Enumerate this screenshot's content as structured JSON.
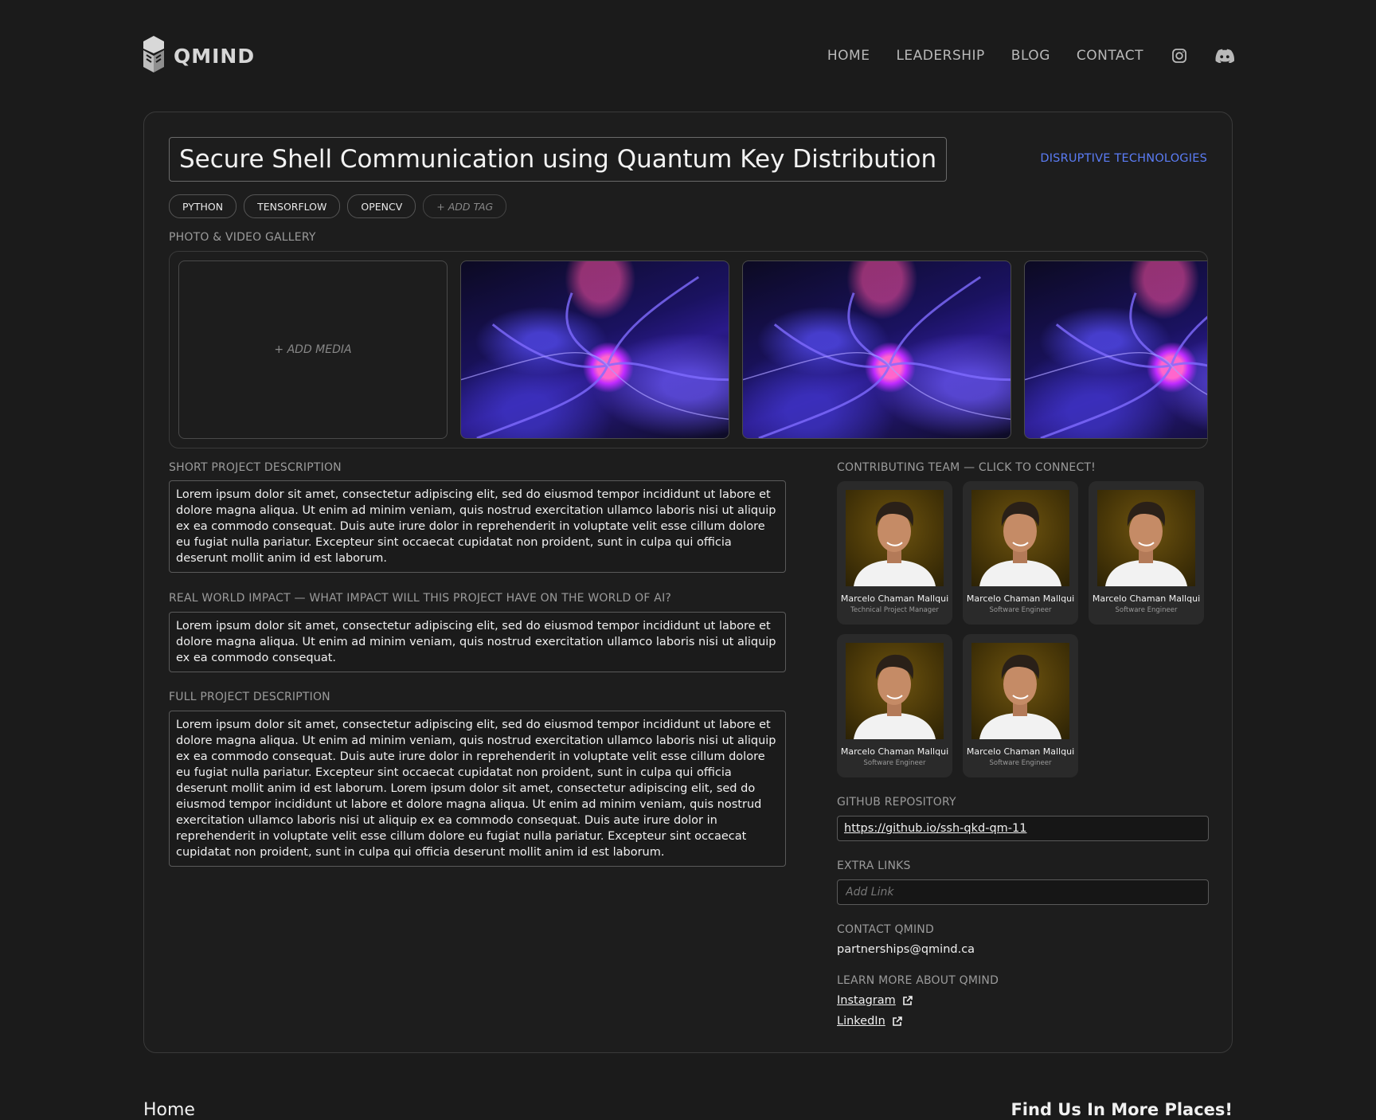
{
  "brand": {
    "name": "QMIND"
  },
  "nav": {
    "items": [
      "HOME",
      "LEADERSHIP",
      "BLOG",
      "CONTACT"
    ],
    "icons": [
      "instagram-icon",
      "discord-icon"
    ]
  },
  "project": {
    "title": "Secure Shell Communication using Quantum Key Distribution",
    "category": "DISRUPTIVE TECHNOLOGIES",
    "tags": [
      "PYTHON",
      "TENSORFLOW",
      "OPENCV"
    ],
    "add_tag": "+ ADD TAG",
    "gallery_label": "PHOTO & VIDEO GALLERY",
    "add_media": "+ ADD MEDIA",
    "short_label": "SHORT PROJECT DESCRIPTION",
    "short_text": "Lorem ipsum dolor sit amet, consectetur adipiscing elit, sed do eiusmod tempor incididunt ut labore et dolore magna aliqua. Ut enim ad minim veniam, quis nostrud exercitation ullamco laboris nisi ut aliquip ex ea commodo consequat. Duis aute irure dolor in reprehenderit in voluptate velit esse cillum dolore eu fugiat nulla pariatur. Excepteur sint occaecat cupidatat non proident, sunt in culpa qui officia deserunt mollit anim id est laborum.",
    "impact_label": "REAL WORLD IMPACT — WHAT IMPACT WILL THIS PROJECT HAVE ON THE WORLD OF AI?",
    "impact_text": "Lorem ipsum dolor sit amet, consectetur adipiscing elit, sed do eiusmod tempor incididunt ut labore et dolore magna aliqua. Ut enim ad minim veniam, quis nostrud exercitation ullamco laboris nisi ut aliquip ex ea commodo consequat.",
    "full_label": "FULL PROJECT DESCRIPTION",
    "full_text": "Lorem ipsum dolor sit amet, consectetur adipiscing elit, sed do eiusmod tempor incididunt ut labore et dolore magna aliqua. Ut enim ad minim veniam, quis nostrud exercitation ullamco laboris nisi ut aliquip ex ea commodo consequat. Duis aute irure dolor in reprehenderit in voluptate velit esse cillum dolore eu fugiat nulla pariatur. Excepteur sint occaecat cupidatat non proident, sunt in culpa qui officia deserunt mollit anim id est laborum. Lorem ipsum dolor sit amet, consectetur adipiscing elit, sed do eiusmod tempor incididunt ut labore et dolore magna aliqua. Ut enim ad minim veniam, quis nostrud exercitation ullamco laboris nisi ut aliquip ex ea commodo consequat. Duis aute irure dolor in reprehenderit in voluptate velit esse cillum dolore eu fugiat nulla pariatur. Excepteur sint occaecat cupidatat non proident, sunt in culpa qui officia deserunt mollit anim id est laborum."
  },
  "team": {
    "label": "CONTRIBUTING TEAM — CLICK TO CONNECT!",
    "members": [
      {
        "name": "Marcelo Chaman Mallqui",
        "role": "Technical Project Manager"
      },
      {
        "name": "Marcelo Chaman Mallqui",
        "role": "Software Engineer"
      },
      {
        "name": "Marcelo Chaman Mallqui",
        "role": "Software Engineer"
      },
      {
        "name": "Marcelo Chaman Mallqui",
        "role": "Software Engineer"
      },
      {
        "name": "Marcelo Chaman Mallqui",
        "role": "Software Engineer"
      }
    ]
  },
  "github": {
    "label": "GITHUB REPOSITORY",
    "url": "https://github.io/ssh-qkd-qm-11"
  },
  "extra_links": {
    "label": "EXTRA LINKS",
    "placeholder": "Add Link"
  },
  "contact": {
    "label": "CONTACT QMIND",
    "email": "partnerships@qmind.ca"
  },
  "learn_more": {
    "label": "LEARN MORE ABOUT QMIND",
    "links": [
      "Instagram",
      "LinkedIn"
    ]
  },
  "footer": {
    "home": "Home",
    "find": "Find Us In More Places!"
  },
  "colors": {
    "accent": "#5b7cf5",
    "background": "#1b1b1b",
    "card": "#1d1d1d"
  }
}
